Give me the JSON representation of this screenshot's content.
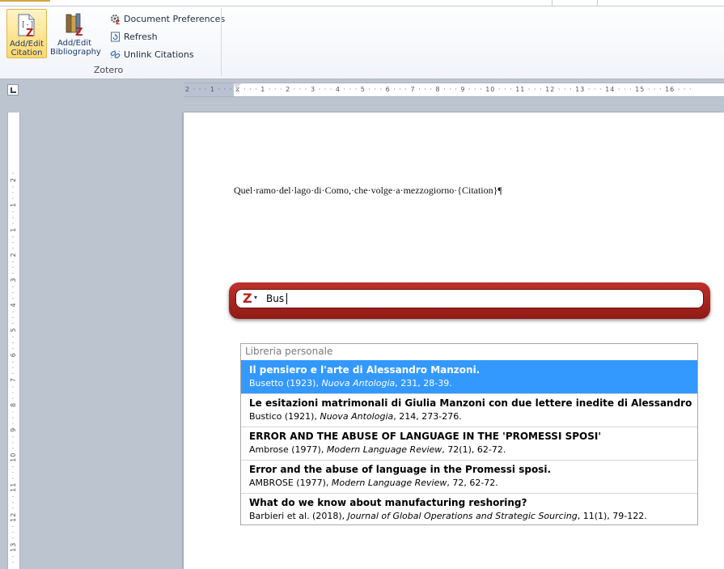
{
  "ribbon": {
    "add_edit_citation": [
      "Add/Edit",
      "Citation"
    ],
    "add_edit_bibliography": [
      "Add/Edit",
      "Bibliography"
    ],
    "document_preferences": "Document Preferences",
    "refresh": "Refresh",
    "unlink_citations": "Unlink Citations",
    "group_label": "Zotero"
  },
  "ruler": {
    "horizontal": "2 · · · 1 · · · ⧖ · · · 1 · · · 2 · · · 3 · · · 4 · · · 5 · · · 6 · · · 7 · · · 8 · · · 9 · · · 10 · · · 11 · · · 12 · · · 13 · · · 14 · · · 15 · · · 16 · · ·",
    "vertical": "· · 13 · · · 12 · · · 11 · · · 10 · · · 9 · · · 8 · · · 7 · · · 6 · · · 5 · · · 4 · · · 3 · · · 2 · · · 1 · · · 1 · · · 2 ·"
  },
  "document": {
    "line": "Quel·ramo·del·lago·di·Como,·che·volge·a·mezzogiorno·{Citation}¶"
  },
  "quick_format": {
    "query": "Bus"
  },
  "results": {
    "header": "Libreria personale",
    "items": [
      {
        "title": "Il pensiero e l'arte di Alessandro Manzoni.",
        "meta_pre": "Busetto (1923), ",
        "meta_em": "Nuova Antologia",
        "meta_post": ", 231, 28-39."
      },
      {
        "title": "Le esitazioni matrimonali di Giulia Manzoni con due lettere inedite di Alessandro Ma...",
        "meta_pre": "Bustico (1921), ",
        "meta_em": "Nuova Antologia",
        "meta_post": ", 214, 273-276."
      },
      {
        "title": "ERROR AND THE ABUSE OF LANGUAGE IN THE 'PROMESSI SPOSI'",
        "meta_pre": "Ambrose (1977), ",
        "meta_em": "Modern Language Review",
        "meta_post": ", 72(1), 62-72."
      },
      {
        "title": "Error and the abuse of language in the Promessi sposi.",
        "meta_pre": "AMBROSE (1977), ",
        "meta_em": "Modern Language Review",
        "meta_post": ", 72, 62-72."
      },
      {
        "title": "What do we know about manufacturing reshoring?",
        "meta_pre": "Barbieri et al. (2018), ",
        "meta_em": "Journal of Global Operations and Strategic Sourcing",
        "meta_post": ", 11(1), 79-122."
      }
    ]
  },
  "colors": {
    "selection": "#3399ff",
    "zotero_red": "#b7221c",
    "ribbon_highlight": "#ffd86b"
  },
  "icons": {
    "citation": "add-edit-citation-icon",
    "bibliography": "add-edit-bibliography-icon",
    "preferences": "document-preferences-icon",
    "refresh": "refresh-icon",
    "unlink": "unlink-citations-icon",
    "zotero": "zotero-z-icon"
  }
}
